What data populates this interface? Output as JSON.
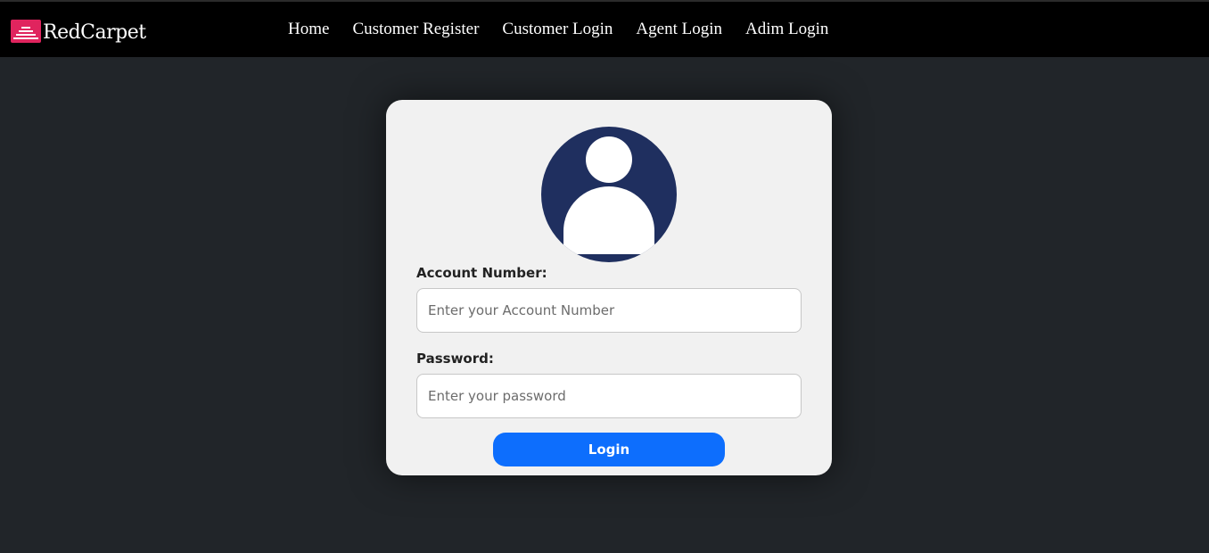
{
  "brand": {
    "name": "RedCarpet",
    "logo_icon": "red-carpet-stairs-icon",
    "logo_color": "#e0245e"
  },
  "nav": {
    "items": [
      {
        "label": "Home"
      },
      {
        "label": "Customer Register"
      },
      {
        "label": "Customer Login"
      },
      {
        "label": "Agent Login"
      },
      {
        "label": "Adim Login"
      }
    ]
  },
  "login_form": {
    "avatar_icon": "user-avatar-icon",
    "account_label": "Account Number:",
    "account_value": "",
    "account_placeholder": "Enter your Account Number",
    "password_label": "Password:",
    "password_value": "",
    "password_placeholder": "Enter your password",
    "submit_label": "Login"
  },
  "colors": {
    "navbar_bg": "#000000",
    "page_bg": "#212529",
    "card_bg": "#f1f1f1",
    "avatar_bg": "#1f2f5f",
    "button_bg": "#0d6efd"
  }
}
